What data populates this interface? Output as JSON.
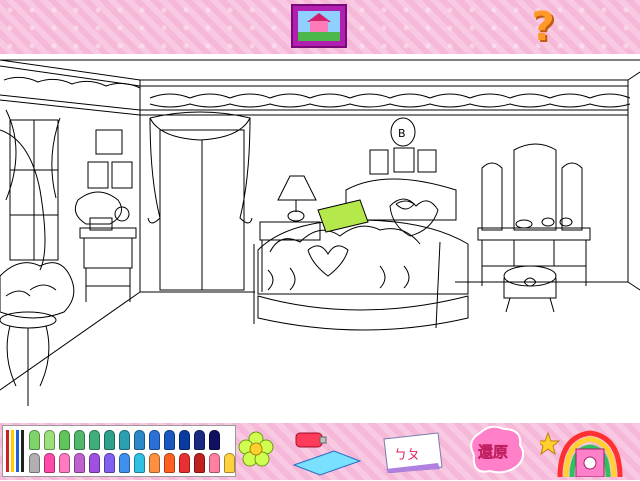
{
  "toolbar": {
    "picture_icon": "house-picture-icon",
    "help_label": "?"
  },
  "palette": {
    "top_row": [
      "#7fd36a",
      "#9be07a",
      "#5fc45a",
      "#4fb86a",
      "#3fae7a",
      "#2fa08a",
      "#2aa0b0",
      "#2a88c8",
      "#2a70d8",
      "#1a58c0",
      "#0a3aa0",
      "#1a2a80",
      "#101060"
    ],
    "bottom_row": [
      "#b0b0b0",
      "#ff4aa8",
      "#ff7ac0",
      "#c060d0",
      "#a050e0",
      "#8060f0",
      "#4090f0",
      "#30c0e0",
      "#ff9040",
      "#ff6020",
      "#e83030",
      "#c02020",
      "#ff80a0",
      "#ffd040"
    ],
    "brushes": [
      "#cc2020",
      "#ffcc00",
      "#2060e0",
      "#222222"
    ]
  },
  "tools": {
    "flower": "flower-stamp-icon",
    "paint": "paint-bucket-icon",
    "text_label": "ㄅㄆ",
    "undo_label": "還原",
    "exit": "rainbow-exit-icon"
  }
}
